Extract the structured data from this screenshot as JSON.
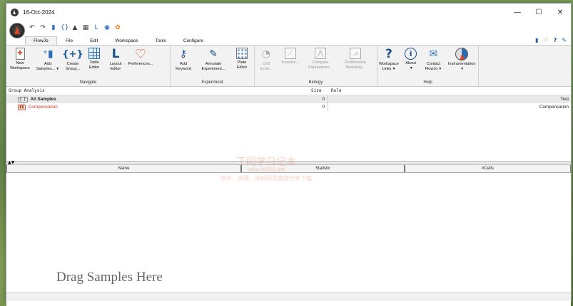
{
  "window": {
    "title": "16-Oct-2024",
    "controls": [
      "—",
      "☐",
      "✕"
    ]
  },
  "menu": {
    "items": [
      "FlowJo",
      "File",
      "Edit",
      "Workspace",
      "Tools",
      "Configure"
    ],
    "active": "FlowJo"
  },
  "ribbon": {
    "groups": [
      {
        "label": "Navigate",
        "buttons": [
          {
            "label1": "New",
            "label2": "Workspace",
            "icon": "new-workspace-icon"
          },
          {
            "label1": "Add",
            "label2": "Samples...",
            "icon": "add-samples-icon",
            "dropdown": true
          },
          {
            "label1": "Create",
            "label2": "Group...",
            "icon": "create-group-icon"
          },
          {
            "label1": "Table",
            "label2": "Editor",
            "icon": "table-editor-icon"
          },
          {
            "label1": "Layout",
            "label2": "Editor",
            "icon": "layout-editor-icon"
          },
          {
            "label1": "Preferences...",
            "label2": "",
            "icon": "preferences-icon"
          }
        ]
      },
      {
        "label": "Experiment",
        "buttons": [
          {
            "label1": "Add",
            "label2": "Keyword",
            "icon": "add-keyword-icon"
          },
          {
            "label1": "Annotate",
            "label2": "Experiment...",
            "icon": "annotate-icon"
          },
          {
            "label1": "Plate",
            "label2": "Editor",
            "icon": "plate-editor-icon"
          }
        ]
      },
      {
        "label": "Biology",
        "buttons": [
          {
            "label1": "Cell",
            "label2": "Cycle...",
            "icon": "cell-cycle-icon",
            "disabled": true
          },
          {
            "label1": "Kinetics...",
            "label2": "",
            "icon": "kinetics-icon",
            "disabled": true
          },
          {
            "label1": "Compare",
            "label2": "Populations...",
            "icon": "compare-populations-icon",
            "disabled": true
          },
          {
            "label1": "Proliferation",
            "label2": "Modeling...",
            "icon": "proliferation-icon",
            "disabled": true
          }
        ]
      },
      {
        "label": "Help",
        "buttons": [
          {
            "label1": "Workspace",
            "label2": "Links",
            "icon": "workspace-links-icon",
            "dropdown": true
          },
          {
            "label1": "About",
            "label2": "",
            "icon": "about-icon",
            "dropdown": true
          },
          {
            "label1": "Contact",
            "label2": "FlowJo",
            "icon": "contact-icon",
            "dropdown": true
          },
          {
            "label1": "Instrumentation",
            "label2": "",
            "icon": "instrumentation-icon",
            "dropdown": true
          }
        ]
      }
    ]
  },
  "group_analysis": {
    "headers": {
      "name": "Group Analysis",
      "size": "Size",
      "role": "Role"
    },
    "rows": [
      {
        "name": "All Samples",
        "size": "0",
        "role": "Test"
      },
      {
        "name": "Compensation",
        "size": "0",
        "role": "Compensation"
      }
    ]
  },
  "samples_table": {
    "headers": {
      "name": "Name",
      "statistic": "Statistic",
      "cells": "#Cells"
    },
    "empty_hint": "Drag Samples Here"
  },
  "watermark": {
    "line1": "丁同学日记本",
    "line2": "www.ts006.net",
    "line3": "软件、资源、资料网盘直接分享下载"
  },
  "colors": {
    "accent": "#2a6fb5",
    "brand_red": "#d24a2a",
    "ribbon_bg": "#f2f2f2"
  }
}
